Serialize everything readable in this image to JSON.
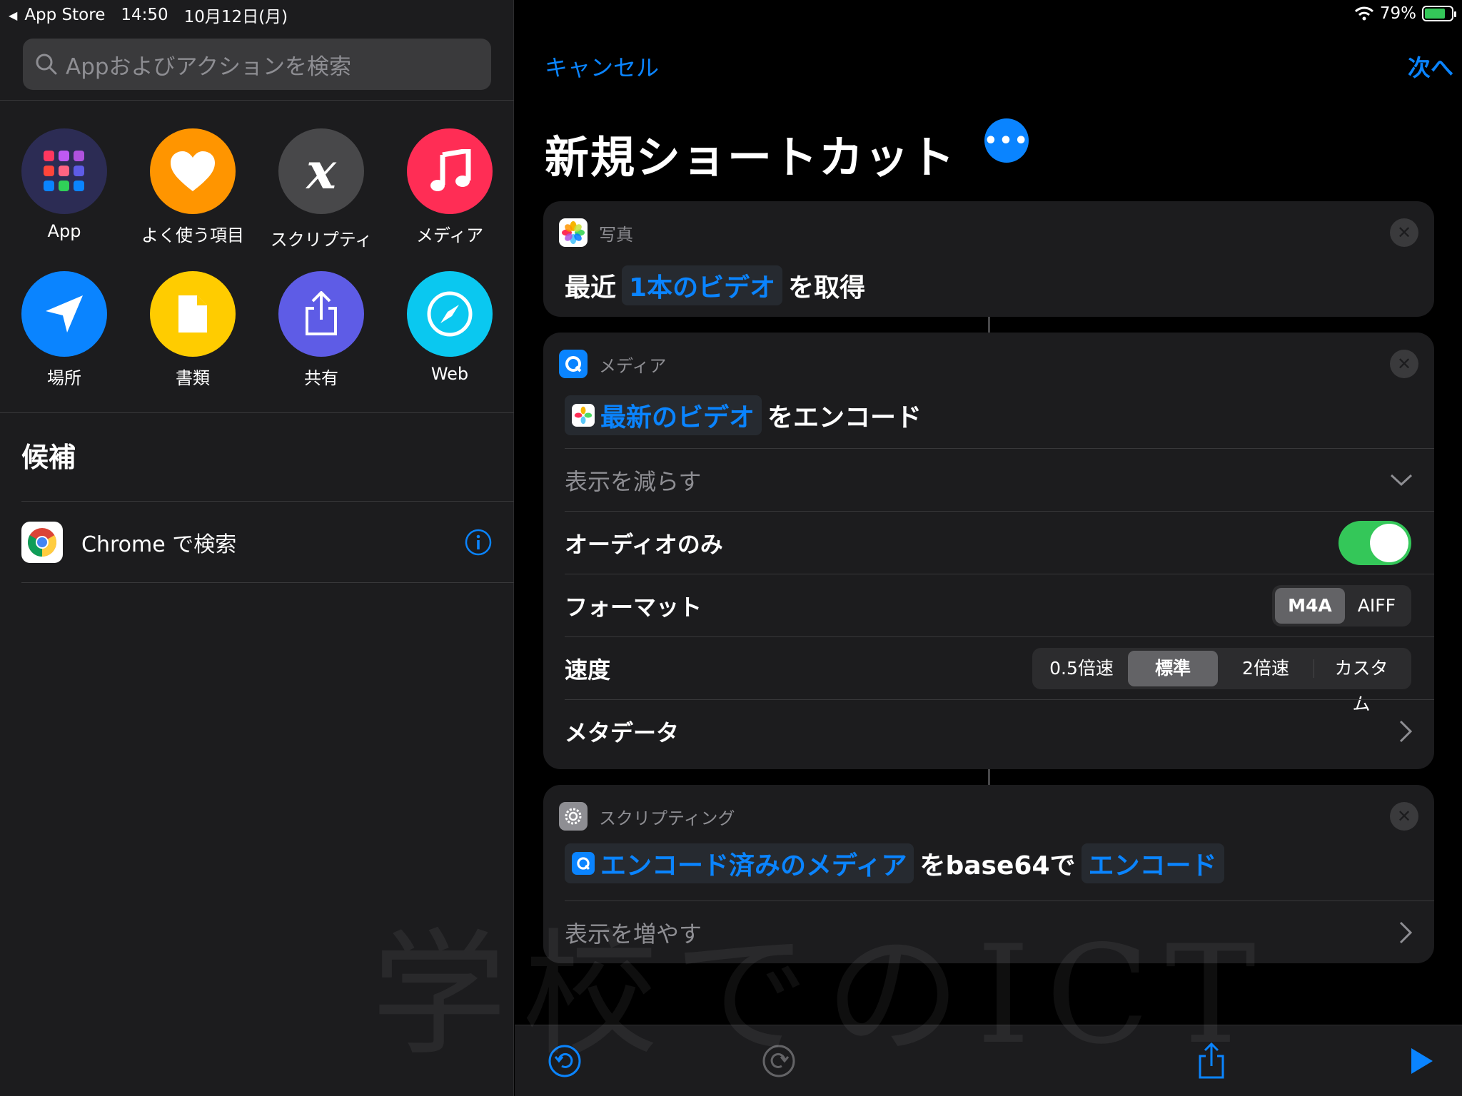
{
  "status_bar": {
    "back_app": "App Store",
    "time": "14:50",
    "date": "10月12日(月)",
    "battery": "79%",
    "battery_level": 0.79
  },
  "sidebar": {
    "search_placeholder": "Appおよびアクションを検索",
    "categories": [
      {
        "label": "App",
        "icon": "app-grid-icon",
        "color": "#2c2c54"
      },
      {
        "label": "よく使う項目",
        "icon": "heart-icon",
        "color": "#ff9500"
      },
      {
        "label": "スクリプティ",
        "icon": "variable-x-icon",
        "color": "#48484a"
      },
      {
        "label": "メディア",
        "icon": "music-note-icon",
        "color": "#ff2d55"
      },
      {
        "label": "場所",
        "icon": "location-arrow-icon",
        "color": "#0a84ff"
      },
      {
        "label": "書類",
        "icon": "document-icon",
        "color": "#ffcc00"
      },
      {
        "label": "共有",
        "icon": "share-icon",
        "color": "#5e5ce6"
      },
      {
        "label": "Web",
        "icon": "compass-icon",
        "color": "#0ac8f0"
      }
    ],
    "suggestions_title": "候補",
    "suggestions": [
      {
        "label": "Chrome で検索",
        "icon": "chrome-icon"
      }
    ]
  },
  "editor": {
    "cancel_label": "キャンセル",
    "next_label": "次へ",
    "title": "新規ショートカット",
    "actions": [
      {
        "app": "写真",
        "parts": {
          "prefix": "最近",
          "token": "1本のビデオ",
          "suffix": "を取得"
        }
      },
      {
        "app": "メディア",
        "parts": {
          "token": "最新のビデオ",
          "suffix": "をエンコード"
        },
        "show_less": "表示を減らす",
        "audio_only_label": "オーディオのみ",
        "audio_only": true,
        "format_label": "フォーマット",
        "format_options": [
          "M4A",
          "AIFF"
        ],
        "format_selected": "M4A",
        "speed_label": "速度",
        "speed_options": [
          "0.5倍速",
          "標準",
          "2倍速",
          "カスタム"
        ],
        "speed_selected": "標準",
        "metadata_label": "メタデータ"
      },
      {
        "app": "スクリプティング",
        "parts": {
          "token": "エンコード済みのメディア",
          "middle": "をbase64で",
          "token2": "エンコード"
        },
        "show_more": "表示を増やす"
      }
    ]
  },
  "watermark": "学校でのICT",
  "colors": {
    "accent": "#0a84ff",
    "toggle_on": "#34c759",
    "panel": "#1c1c1e"
  }
}
